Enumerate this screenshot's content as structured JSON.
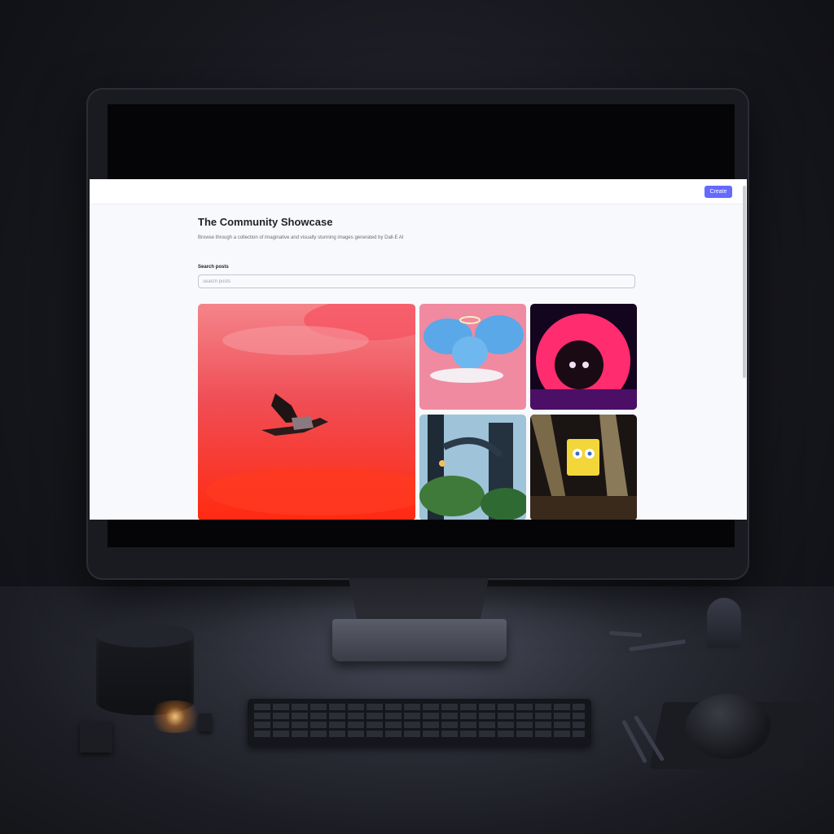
{
  "navbar": {
    "create_label": "Create"
  },
  "main": {
    "title": "The Community Showcase",
    "subtitle": "Browse through a collection of imaginative and visually stunning images generated by Dall-E AI"
  },
  "search": {
    "label": "Search posts",
    "placeholder": "search posts",
    "value": ""
  },
  "gallery": {
    "items": [
      {
        "subject": "red sky bird",
        "accent": "#ff3b2a"
      },
      {
        "subject": "winged elephant",
        "accent": "#f28aa0"
      },
      {
        "subject": "neon hedgehog",
        "accent": "#ff2d6f"
      },
      {
        "subject": "futuristic jungle",
        "accent": "#3f7a3a"
      },
      {
        "subject": "sponge in forest",
        "accent": "#f2d63a"
      }
    ]
  },
  "colors": {
    "primary_button": "#6469ff",
    "page_bg": "#f8f9fc",
    "title": "#222328"
  }
}
